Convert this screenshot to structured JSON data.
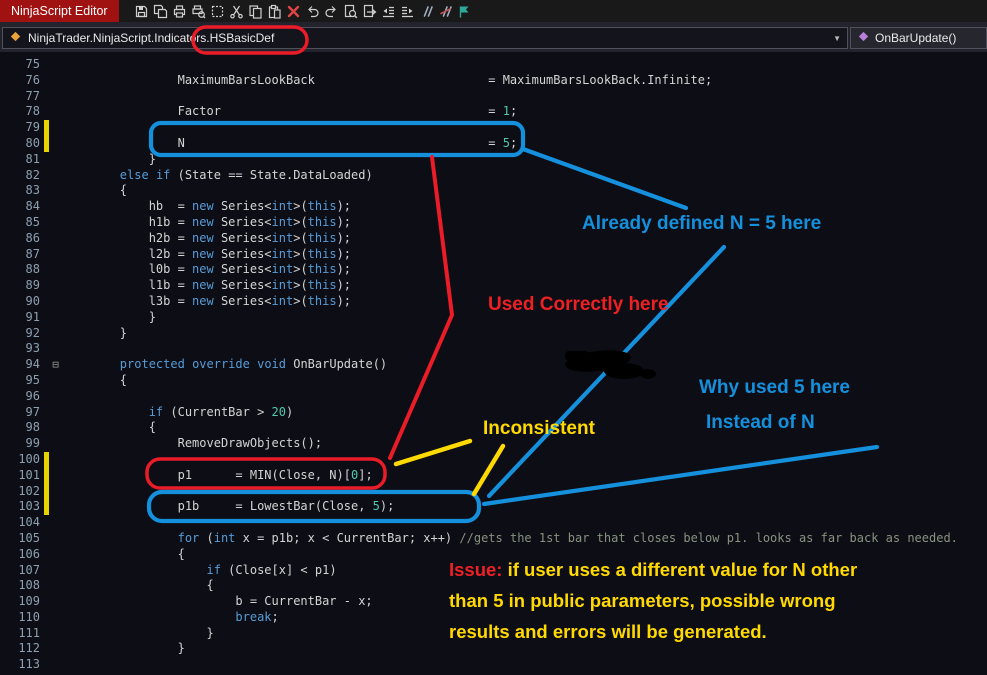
{
  "window": {
    "tab_title": "NinjaScript Editor"
  },
  "toolbar": {
    "icons": [
      "save",
      "save-all",
      "print",
      "print-preview",
      "selection",
      "cut",
      "copy",
      "paste",
      "delete",
      "undo",
      "redo",
      "find-in-files",
      "go-to-definition",
      "decrease-indent",
      "increase-indent",
      "comment-selection",
      "uncomment-selection",
      "compile"
    ]
  },
  "navbar": {
    "class_path": "NinjaTrader.NinjaScript.Indicators.HSBasicDef",
    "method": "OnBarUpdate()",
    "dropdown_chevron": "▼"
  },
  "editor": {
    "colors": {
      "background": "#0d0d15",
      "plain": "#d4d4d4",
      "keyword": "#569cd6",
      "number": "#4ec9b0",
      "comment": "#87937f",
      "line_number": "#8ca0b0",
      "changed_marker": "#e6d300"
    },
    "lines": [
      {
        "n": 75,
        "ch": false,
        "fold": "",
        "seg": []
      },
      {
        "n": 76,
        "ch": false,
        "fold": "",
        "seg": [
          [
            "pl",
            "                MaximumBarsLookBack                        = MaximumBarsLookBack.Infinite;"
          ]
        ]
      },
      {
        "n": 77,
        "ch": false,
        "fold": "",
        "seg": []
      },
      {
        "n": 78,
        "ch": false,
        "fold": "",
        "seg": [
          [
            "pl",
            "                Factor                                     = "
          ],
          [
            "num",
            "1"
          ],
          [
            "pl",
            ";"
          ]
        ]
      },
      {
        "n": 79,
        "ch": true,
        "fold": "",
        "seg": []
      },
      {
        "n": 80,
        "ch": true,
        "fold": "",
        "seg": [
          [
            "pl",
            "                N                                          = "
          ],
          [
            "num",
            "5"
          ],
          [
            "pl",
            ";"
          ]
        ]
      },
      {
        "n": 81,
        "ch": false,
        "fold": "",
        "seg": [
          [
            "pl",
            "            }"
          ]
        ]
      },
      {
        "n": 82,
        "ch": false,
        "fold": "",
        "seg": [
          [
            "pl",
            "        "
          ],
          [
            "kw",
            "else"
          ],
          [
            "pl",
            " "
          ],
          [
            "kw",
            "if"
          ],
          [
            "pl",
            " (State == State.DataLoaded)"
          ]
        ]
      },
      {
        "n": 83,
        "ch": false,
        "fold": "",
        "seg": [
          [
            "pl",
            "        {"
          ]
        ]
      },
      {
        "n": 84,
        "ch": false,
        "fold": "",
        "seg": [
          [
            "pl",
            "            hb  = "
          ],
          [
            "kw",
            "new"
          ],
          [
            "pl",
            " Series<"
          ],
          [
            "kw",
            "int"
          ],
          [
            "pl",
            ">("
          ],
          [
            "kw",
            "this"
          ],
          [
            "pl",
            ");"
          ]
        ]
      },
      {
        "n": 85,
        "ch": false,
        "fold": "",
        "seg": [
          [
            "pl",
            "            h1b = "
          ],
          [
            "kw",
            "new"
          ],
          [
            "pl",
            " Series<"
          ],
          [
            "kw",
            "int"
          ],
          [
            "pl",
            ">("
          ],
          [
            "kw",
            "this"
          ],
          [
            "pl",
            ");"
          ]
        ]
      },
      {
        "n": 86,
        "ch": false,
        "fold": "",
        "seg": [
          [
            "pl",
            "            h2b = "
          ],
          [
            "kw",
            "new"
          ],
          [
            "pl",
            " Series<"
          ],
          [
            "kw",
            "int"
          ],
          [
            "pl",
            ">("
          ],
          [
            "kw",
            "this"
          ],
          [
            "pl",
            ");"
          ]
        ]
      },
      {
        "n": 87,
        "ch": false,
        "fold": "",
        "seg": [
          [
            "pl",
            "            l2b = "
          ],
          [
            "kw",
            "new"
          ],
          [
            "pl",
            " Series<"
          ],
          [
            "kw",
            "int"
          ],
          [
            "pl",
            ">("
          ],
          [
            "kw",
            "this"
          ],
          [
            "pl",
            ");"
          ]
        ]
      },
      {
        "n": 88,
        "ch": false,
        "fold": "",
        "seg": [
          [
            "pl",
            "            l0b = "
          ],
          [
            "kw",
            "new"
          ],
          [
            "pl",
            " Series<"
          ],
          [
            "kw",
            "int"
          ],
          [
            "pl",
            ">("
          ],
          [
            "kw",
            "this"
          ],
          [
            "pl",
            ");"
          ]
        ]
      },
      {
        "n": 89,
        "ch": false,
        "fold": "",
        "seg": [
          [
            "pl",
            "            l1b = "
          ],
          [
            "kw",
            "new"
          ],
          [
            "pl",
            " Series<"
          ],
          [
            "kw",
            "int"
          ],
          [
            "pl",
            ">("
          ],
          [
            "kw",
            "this"
          ],
          [
            "pl",
            ");"
          ]
        ]
      },
      {
        "n": 90,
        "ch": false,
        "fold": "",
        "seg": [
          [
            "pl",
            "            l3b = "
          ],
          [
            "kw",
            "new"
          ],
          [
            "pl",
            " Series<"
          ],
          [
            "kw",
            "int"
          ],
          [
            "pl",
            ">("
          ],
          [
            "kw",
            "this"
          ],
          [
            "pl",
            ");"
          ]
        ]
      },
      {
        "n": 91,
        "ch": false,
        "fold": "",
        "seg": [
          [
            "pl",
            "            }"
          ]
        ]
      },
      {
        "n": 92,
        "ch": false,
        "fold": "",
        "seg": [
          [
            "pl",
            "        }"
          ]
        ]
      },
      {
        "n": 93,
        "ch": false,
        "fold": "",
        "seg": []
      },
      {
        "n": 94,
        "ch": false,
        "fold": "⊟",
        "seg": [
          [
            "pl",
            "        "
          ],
          [
            "kw",
            "protected"
          ],
          [
            "pl",
            " "
          ],
          [
            "kw",
            "override"
          ],
          [
            "pl",
            " "
          ],
          [
            "kw",
            "void"
          ],
          [
            "pl",
            " OnBarUpdate()"
          ]
        ]
      },
      {
        "n": 95,
        "ch": false,
        "fold": "",
        "seg": [
          [
            "pl",
            "        {"
          ]
        ]
      },
      {
        "n": 96,
        "ch": false,
        "fold": "",
        "seg": []
      },
      {
        "n": 97,
        "ch": false,
        "fold": "",
        "seg": [
          [
            "pl",
            "            "
          ],
          [
            "kw",
            "if"
          ],
          [
            "pl",
            " (CurrentBar > "
          ],
          [
            "num",
            "20"
          ],
          [
            "pl",
            ")"
          ]
        ]
      },
      {
        "n": 98,
        "ch": false,
        "fold": "",
        "seg": [
          [
            "pl",
            "            {"
          ]
        ]
      },
      {
        "n": 99,
        "ch": false,
        "fold": "",
        "seg": [
          [
            "pl",
            "                RemoveDrawObjects();"
          ]
        ]
      },
      {
        "n": 100,
        "ch": true,
        "fold": "",
        "seg": []
      },
      {
        "n": 101,
        "ch": true,
        "fold": "",
        "seg": [
          [
            "pl",
            "                p1      = MIN(Close, N)["
          ],
          [
            "num",
            "0"
          ],
          [
            "pl",
            "];"
          ]
        ]
      },
      {
        "n": 102,
        "ch": true,
        "fold": "",
        "seg": []
      },
      {
        "n": 103,
        "ch": true,
        "fold": "",
        "seg": [
          [
            "pl",
            "                p1b     = LowestBar(Close, "
          ],
          [
            "num",
            "5"
          ],
          [
            "pl",
            ");"
          ]
        ]
      },
      {
        "n": 104,
        "ch": false,
        "fold": "",
        "seg": []
      },
      {
        "n": 105,
        "ch": false,
        "fold": "",
        "seg": [
          [
            "pl",
            "                "
          ],
          [
            "kw",
            "for"
          ],
          [
            "pl",
            " ("
          ],
          [
            "kw",
            "int"
          ],
          [
            "pl",
            " x = p1b; x < CurrentBar; x++) "
          ],
          [
            "cm",
            "//gets the 1st bar that closes below p1. looks as far back as needed."
          ]
        ]
      },
      {
        "n": 106,
        "ch": false,
        "fold": "",
        "seg": [
          [
            "pl",
            "                {"
          ]
        ]
      },
      {
        "n": 107,
        "ch": false,
        "fold": "",
        "seg": [
          [
            "pl",
            "                    "
          ],
          [
            "kw",
            "if"
          ],
          [
            "pl",
            " (Close[x] < p1)"
          ]
        ]
      },
      {
        "n": 108,
        "ch": false,
        "fold": "",
        "seg": [
          [
            "pl",
            "                    {"
          ]
        ]
      },
      {
        "n": 109,
        "ch": false,
        "fold": "",
        "seg": [
          [
            "pl",
            "                        b = CurrentBar - x;"
          ]
        ]
      },
      {
        "n": 110,
        "ch": false,
        "fold": "",
        "seg": [
          [
            "pl",
            "                        "
          ],
          [
            "kw",
            "break"
          ],
          [
            "pl",
            ";"
          ]
        ]
      },
      {
        "n": 111,
        "ch": false,
        "fold": "",
        "seg": [
          [
            "pl",
            "                    }"
          ]
        ]
      },
      {
        "n": 112,
        "ch": false,
        "fold": "",
        "seg": [
          [
            "pl",
            "                }"
          ]
        ]
      },
      {
        "n": 113,
        "ch": false,
        "fold": "",
        "seg": []
      }
    ]
  },
  "annotations": {
    "colors": {
      "red": "#ea1c28",
      "blue": "#1590dd",
      "yellow": "#ffd900"
    },
    "already_defined": "Already defined N = 5 here",
    "used_correctly": "Used Correctly here",
    "inconsistent": "Inconsistent",
    "why_used": "Why used 5 here",
    "instead_of": "Instead of N",
    "issue": {
      "label": "Issue:",
      "line1": " if user uses a different value for N other",
      "line2": "than 5 in public parameters, possible wrong",
      "line3": "results and errors will be generated."
    }
  }
}
